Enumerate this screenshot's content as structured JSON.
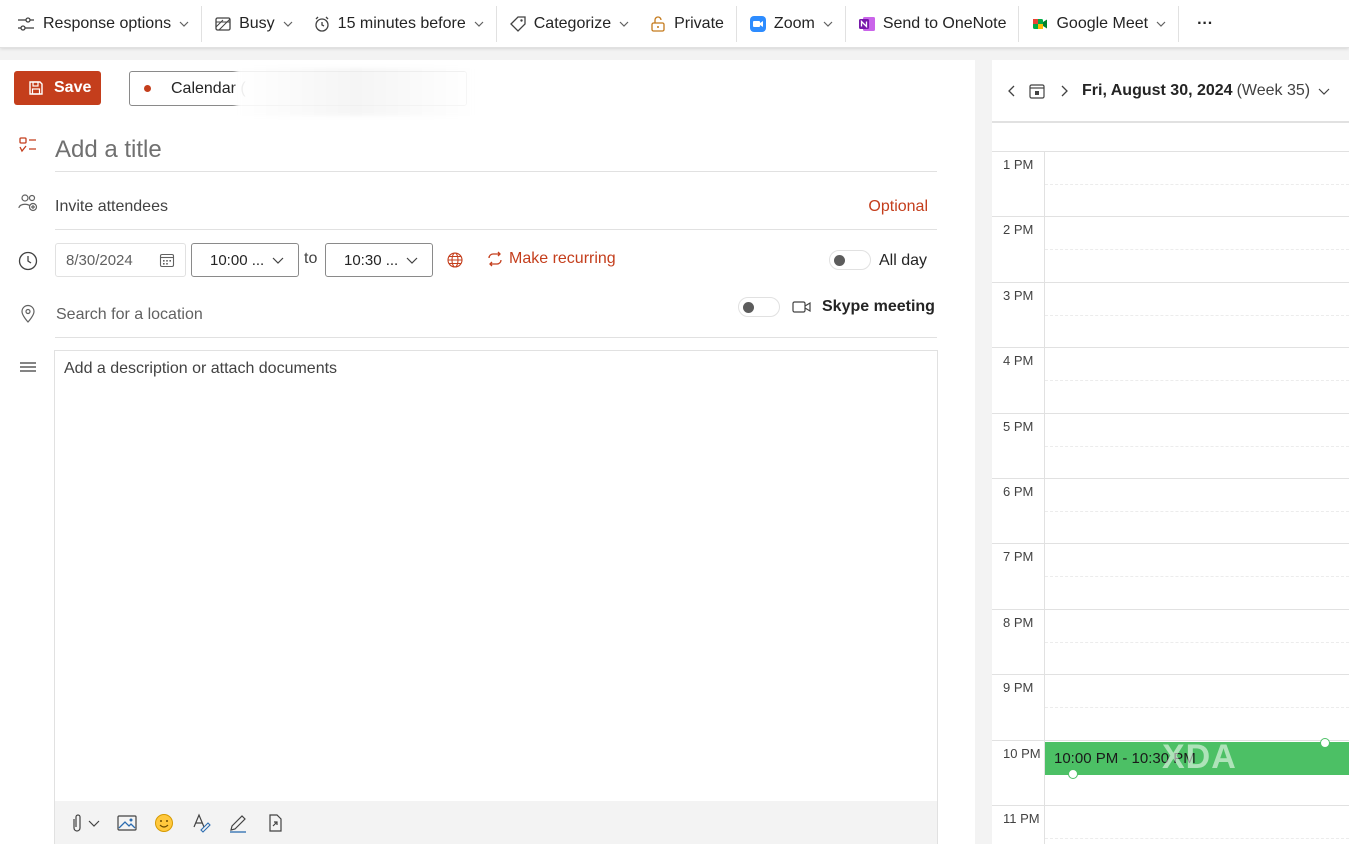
{
  "toolbar": {
    "response_options": "Response options",
    "busy": "Busy",
    "reminder": "15 minutes before",
    "categorize": "Categorize",
    "private": "Private",
    "zoom": "Zoom",
    "onenote": "Send to OneNote",
    "google_meet": "Google Meet",
    "more": "···"
  },
  "editor": {
    "save_label": "Save",
    "calendar_label": "Calendar (",
    "title_placeholder": "Add a title",
    "attendees_placeholder": "Invite attendees",
    "optional_label": "Optional",
    "start_date": "8/30/2024",
    "start_time": "10:00 ...",
    "to_label": "to",
    "end_time": "10:30 ...",
    "recurring_label": "Make recurring",
    "allday_label": "All day",
    "location_placeholder": "Search for a location",
    "skype_label": "Skype meeting",
    "description_placeholder": "Add a description or attach documents"
  },
  "day_view": {
    "date": "Fri, August 30, 2024",
    "week": "(Week 35)",
    "hours": [
      "1 PM",
      "2 PM",
      "3 PM",
      "4 PM",
      "5 PM",
      "6 PM",
      "7 PM",
      "8 PM",
      "9 PM",
      "10 PM",
      "11 PM"
    ],
    "event_label": "10:00 PM - 10:30 PM",
    "watermark": "XDA"
  },
  "colors": {
    "accent": "#c43e1c",
    "event": "#4cc065"
  }
}
